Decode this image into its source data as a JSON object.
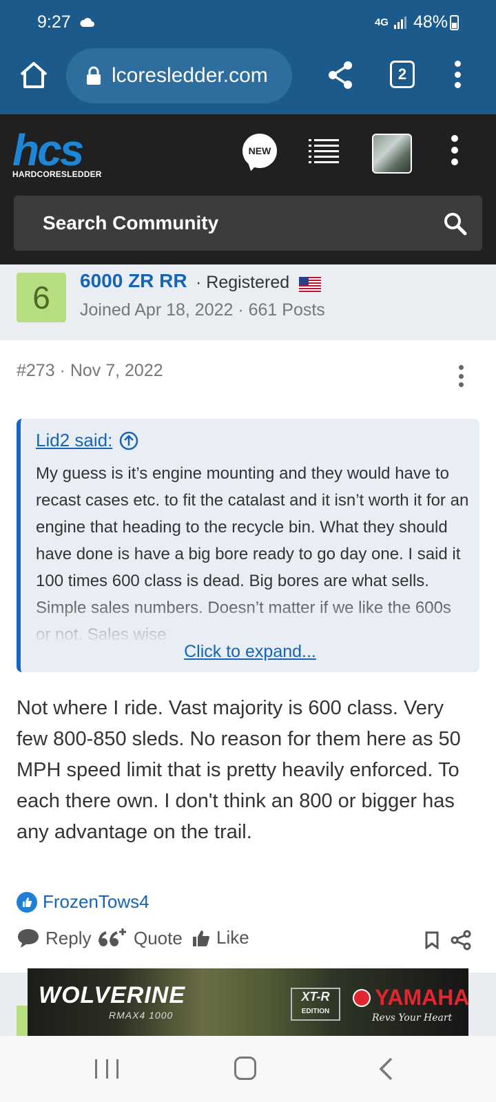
{
  "status_bar": {
    "time": "9:27",
    "network": "4G",
    "battery": "48%"
  },
  "browser": {
    "url": "lcoresledder.com",
    "tab_count": "2"
  },
  "site": {
    "logo_letters": "hcs",
    "logo_subtitle": "HARDCORESLEDDER",
    "new_label": "NEW",
    "search_placeholder": "Search Community"
  },
  "user": {
    "avatar_letter": "6",
    "name": "6000 ZR RR",
    "role": "· Registered",
    "joined": "Joined Apr 18, 2022 · 661 Posts"
  },
  "post": {
    "meta": "#273 · Nov 7, 2022",
    "quote": {
      "author": "Lid2 said:",
      "text": "My guess is it’s engine mounting and they would have to recast cases etc. to fit the catalast and it isn’t worth it for an engine that heading to the recycle bin. What they should have done is have a big bore ready to go day one. I said it 100 times 600 class is dead. Big bores are what sells. Simple sales numbers. Doesn’t matter if we like the 600s or not. Sales wise",
      "expand_label": "Click to expand..."
    },
    "body": "Not where I ride. Vast majority is 600 class. Very few 800-850 sleds. No reason for them here as 50 MPH speed limit that is pretty heavily enforced. To each there own. I don't think an 800 or bigger has any advantage on the trail.",
    "liked_by": "FrozenTows4",
    "actions": {
      "reply": "Reply",
      "quote": "Quote",
      "like": "Like"
    }
  },
  "ad": {
    "brand": "WOLVERINE",
    "model": "RMAX4 1000",
    "edition_top": "XT-R",
    "edition_bottom": "EDITION",
    "maker": "YAMAHA",
    "tagline": "Revs Your Heart"
  },
  "colors": {
    "browser_bar": "#1b5a8a",
    "site_header": "#202020",
    "link_blue": "#1565b6",
    "quote_border": "#1565c8",
    "avatar_green": "#b6de7e"
  }
}
